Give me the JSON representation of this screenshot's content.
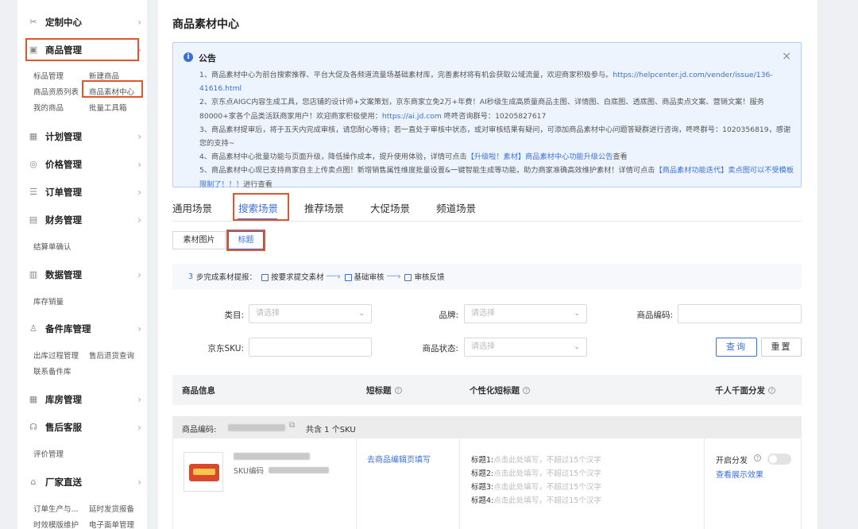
{
  "sidebar": {
    "sections": [
      {
        "label": "定制中心",
        "icon": "scissors-icon"
      },
      {
        "label": "商品管理",
        "icon": "bag-icon"
      },
      {
        "label": "计划管理",
        "icon": "grid-icon"
      },
      {
        "label": "价格管理",
        "icon": "coin-icon"
      },
      {
        "label": "订单管理",
        "icon": "list-icon"
      },
      {
        "label": "财务管理",
        "icon": "wallet-icon"
      },
      {
        "label": "数据管理",
        "icon": "chart-icon"
      },
      {
        "label": "备件库管理",
        "icon": "people-icon"
      },
      {
        "label": "库房管理",
        "icon": "grid-icon"
      },
      {
        "label": "售后客服",
        "icon": "headset-icon"
      },
      {
        "label": "厂家直送",
        "icon": "store-icon"
      }
    ],
    "product_items": [
      "标品管理",
      "新建商品",
      "商品资质列表",
      "商品素材中心",
      "我的商品",
      "批量工具箱"
    ],
    "finance_items": [
      "结算单确认"
    ],
    "data_items": [
      "库存销量"
    ],
    "parts_items": [
      "出库过程管理",
      "售后退货查询",
      "联系备件库"
    ],
    "service_items": [
      "评价管理"
    ],
    "direct_items": [
      "订单生产与...",
      "延时发货报备",
      "时效模版维护",
      "电子面单管理"
    ]
  },
  "page": {
    "title": "商品素材中心"
  },
  "notice": {
    "title": "公告",
    "close": "×",
    "lines": [
      {
        "text": "1、商品素材中心为前台搜索推荐、平台大促及各频道流量场基础素材库，完善素材将有机会获取公域流量，欢迎商家积极参与。",
        "link": "https://helpcenter.jd.com/vender/issue/136-41616.html"
      },
      {
        "text": "2、京东点AIGC内容生成工具，您店铺的设计师+文案策划，京东商家立免2万+年费！AI秒级生成高质量商品主图、详情图、白底图、透底图、商品卖点文案、营销文案！服务80000+家各个品类活跃商家用户！欢迎商家积极使用：",
        "link": "https://ai.jd.com",
        "suffix": " 咚咚咨询群号：10205827617"
      },
      {
        "text": "3、商品素材提审后，将于五天内完成审核，请您耐心等待；若一直处于审核中状态，或对审核结果有疑问，可添加商品素材中心问题答疑群进行咨询，咚咚群号：1020356819，感谢您的支持~"
      },
      {
        "text": "4、商品素材中心批量功能与页面升级，降低操作成本，提升使用体验，详情可点击",
        "link": "【升级啦！素材】商品素材中心功能升级公告",
        "suffix": "查看"
      },
      {
        "text": "5、商品素材中心现已支持商家自主上传卖点图！新增销售属性维度批量设置&一键智能生成等功能，助力商家准确高效维护素材！详情可点击",
        "link": "【商品素材功能迭代】卖点图可以不受模板限制了！！！",
        "suffix": "进行查看"
      }
    ]
  },
  "tabs": [
    "通用场景",
    "搜索场景",
    "推荐场景",
    "大促场景",
    "频道场景"
  ],
  "segments": [
    "素材图片",
    "标题"
  ],
  "steps": {
    "number": "3",
    "intro": "步完成素材提报：",
    "items": [
      "按要求提交素材",
      "基础审核",
      "审核反馈"
    ]
  },
  "filters": {
    "category_label": "类目:",
    "category_placeholder": "请选择",
    "brand_label": "品牌:",
    "brand_placeholder": "请选择",
    "code_label": "商品编码:",
    "sku_label": "京东SKU:",
    "status_label": "商品状态:",
    "status_placeholder": "请选择",
    "query_btn": "查询",
    "reset_btn": "重置"
  },
  "table": {
    "headers": [
      "商品信息",
      "短标题",
      "个性化短标题",
      "千人千面分发"
    ],
    "group": {
      "code_label": "商品编码:",
      "sku_count": "共含 1 个SKU"
    },
    "row": {
      "sku_label": "SKU编码",
      "short_title_link": "去商品编辑页填写",
      "subtitles": [
        {
          "label": "标题1:",
          "placeholder": "点击此处填写，不超过15个汉字"
        },
        {
          "label": "标题2:",
          "placeholder": "点击此处填写，不超过15个汉字"
        },
        {
          "label": "标题3:",
          "placeholder": "点击此处填写，不超过15个汉字"
        },
        {
          "label": "标题4:",
          "placeholder": "点击此处填写，不超过15个汉字"
        }
      ],
      "dist_label": "开启分发",
      "view_link": "查看展示效果"
    }
  },
  "colors": {
    "accent": "#3a6fd9",
    "highlight": "#e0542e",
    "notice_bg": "#eef4fe"
  }
}
